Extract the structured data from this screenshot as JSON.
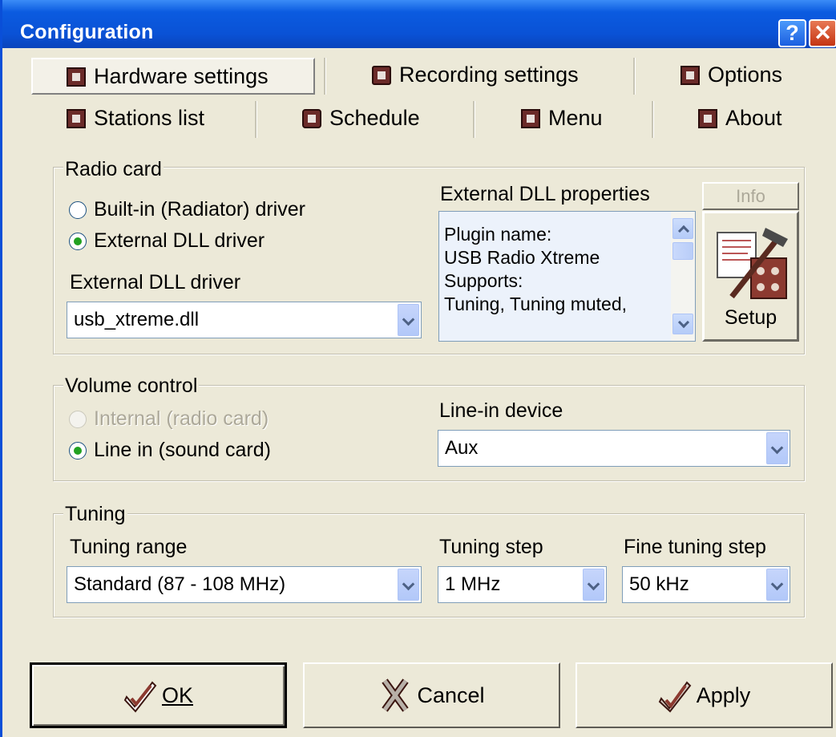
{
  "window": {
    "title": "Configuration",
    "help_label": "?",
    "close_label": "✕"
  },
  "tabs": {
    "row1": [
      {
        "label": "Hardware settings",
        "icon": "plug-icon",
        "active": true
      },
      {
        "label": "Recording settings",
        "icon": "record-icon",
        "active": false
      },
      {
        "label": "Options",
        "icon": "monitor-icon",
        "active": false
      }
    ],
    "row2": [
      {
        "label": "Stations list",
        "icon": "signal-icon",
        "active": false
      },
      {
        "label": "Schedule",
        "icon": "clock-icon",
        "active": false
      },
      {
        "label": "Menu",
        "icon": "menu-icon",
        "active": false
      },
      {
        "label": "About",
        "icon": "broadcast-icon",
        "active": false
      }
    ]
  },
  "radio_card": {
    "group_label": "Radio card",
    "builtin_label": "Built-in (Radiator) driver",
    "builtin_checked": false,
    "external_label": "External DLL driver",
    "external_checked": true,
    "dll_driver_label": "External DLL driver",
    "dll_driver_value": "usb_xtreme.dll",
    "properties_label": "External DLL properties",
    "properties_lines": [
      "Plugin name:",
      "USB Radio Xtreme",
      "Supports:",
      "Tuning, Tuning muted,"
    ],
    "info_label": "Info",
    "setup_label": "Setup"
  },
  "volume_control": {
    "group_label": "Volume control",
    "internal_label": "Internal (radio card)",
    "internal_enabled": false,
    "linein_label": "Line in (sound card)",
    "linein_checked": true,
    "device_label": "Line-in device",
    "device_value": "Aux"
  },
  "tuning": {
    "group_label": "Tuning",
    "range_label": "Tuning range",
    "range_value": "Standard (87 - 108 MHz)",
    "step_label": "Tuning step",
    "step_value": "1 MHz",
    "fine_label": "Fine tuning step",
    "fine_value": "50 kHz"
  },
  "buttons": {
    "ok_label": "OK",
    "cancel_label": "Cancel",
    "apply_label": "Apply"
  },
  "colors": {
    "titlebar": "#0a52d6",
    "dialog_bg": "#ece9d8",
    "tab_icon": "#6b2b29",
    "radio_checked": "#21a121"
  }
}
